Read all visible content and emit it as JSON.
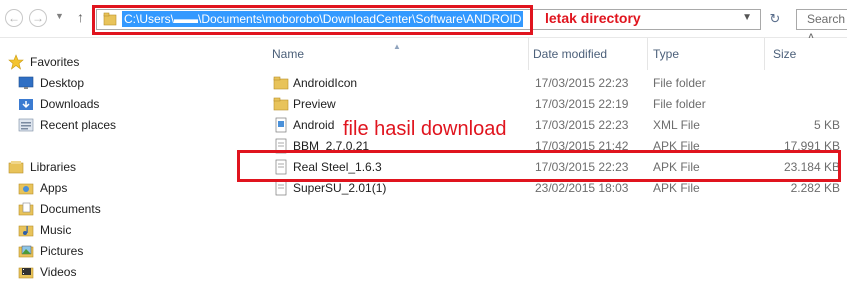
{
  "address_bar": {
    "path": "C:\\Users\\▬▬\\Documents\\moborobo\\DownloadCenter\\Software\\ANDROID",
    "search_placeholder": "Search A",
    "back_icon": "arrow-left-icon",
    "forward_icon": "arrow-right-icon",
    "up_icon": "arrow-up-icon",
    "refresh_icon": "refresh-icon"
  },
  "sidebar": {
    "favorites_label": "Favorites",
    "favorites": [
      {
        "label": "Desktop",
        "icon": "desktop-icon"
      },
      {
        "label": "Downloads",
        "icon": "downloads-icon"
      },
      {
        "label": "Recent places",
        "icon": "recent-places-icon"
      }
    ],
    "libraries_label": "Libraries",
    "libraries": [
      {
        "label": "Apps",
        "icon": "apps-icon"
      },
      {
        "label": "Documents",
        "icon": "documents-icon"
      },
      {
        "label": "Music",
        "icon": "music-icon"
      },
      {
        "label": "Pictures",
        "icon": "pictures-icon"
      },
      {
        "label": "Videos",
        "icon": "videos-icon"
      }
    ]
  },
  "columns": {
    "name": "Name",
    "date_modified": "Date modified",
    "type": "Type",
    "size": "Size"
  },
  "files": [
    {
      "name": "AndroidIcon",
      "date": "17/03/2015 22:23",
      "type": "File folder",
      "size": "",
      "icon": "folder-icon"
    },
    {
      "name": "Preview",
      "date": "17/03/2015 22:19",
      "type": "File folder",
      "size": "",
      "icon": "folder-icon"
    },
    {
      "name": "Android",
      "date": "17/03/2015 22:23",
      "type": "XML File",
      "size": "5 KB",
      "icon": "xml-file-icon"
    },
    {
      "name": "BBM_2.7.0.21",
      "date": "17/03/2015 21:42",
      "type": "APK File",
      "size": "17.991 KB",
      "icon": "apk-file-icon"
    },
    {
      "name": "Real Steel_1.6.3",
      "date": "17/03/2015 22:23",
      "type": "APK File",
      "size": "23.184 KB",
      "icon": "apk-file-icon"
    },
    {
      "name": "SuperSU_2.01(1)",
      "date": "23/02/2015 18:03",
      "type": "APK File",
      "size": "2.282 KB",
      "icon": "apk-file-icon"
    }
  ],
  "annotations": {
    "directory_label": "letak directory",
    "download_label": "file hasil download",
    "color": "#e0141e"
  },
  "colors": {
    "selection": "#3399ff",
    "header_text": "#4c607a",
    "annotation": "#e0141e"
  }
}
